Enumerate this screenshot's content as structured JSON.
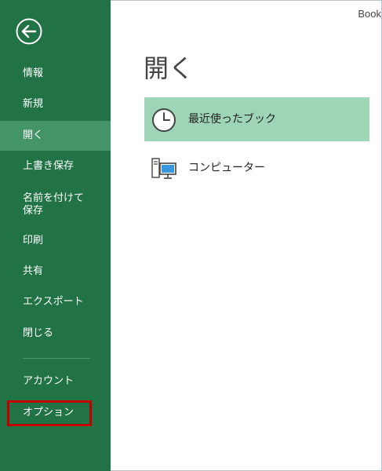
{
  "window": {
    "title": "Book"
  },
  "sidebar": {
    "items": [
      {
        "label": "情報"
      },
      {
        "label": "新規"
      },
      {
        "label": "開く"
      },
      {
        "label": "上書き保存"
      },
      {
        "label": "名前を付けて\n保存"
      },
      {
        "label": "印刷"
      },
      {
        "label": "共有"
      },
      {
        "label": "エクスポート"
      },
      {
        "label": "閉じる"
      },
      {
        "label": "アカウント"
      },
      {
        "label": "オプション"
      }
    ]
  },
  "main": {
    "title": "開く",
    "locations": [
      {
        "label": "最近使ったブック",
        "icon": "clock-icon"
      },
      {
        "label": "コンピューター",
        "icon": "computer-icon"
      }
    ]
  },
  "colors": {
    "sidebar": "#217346",
    "sidebar_selected": "#439467",
    "location_selected": "#9fd5b7",
    "highlight_box": "#c00000"
  }
}
